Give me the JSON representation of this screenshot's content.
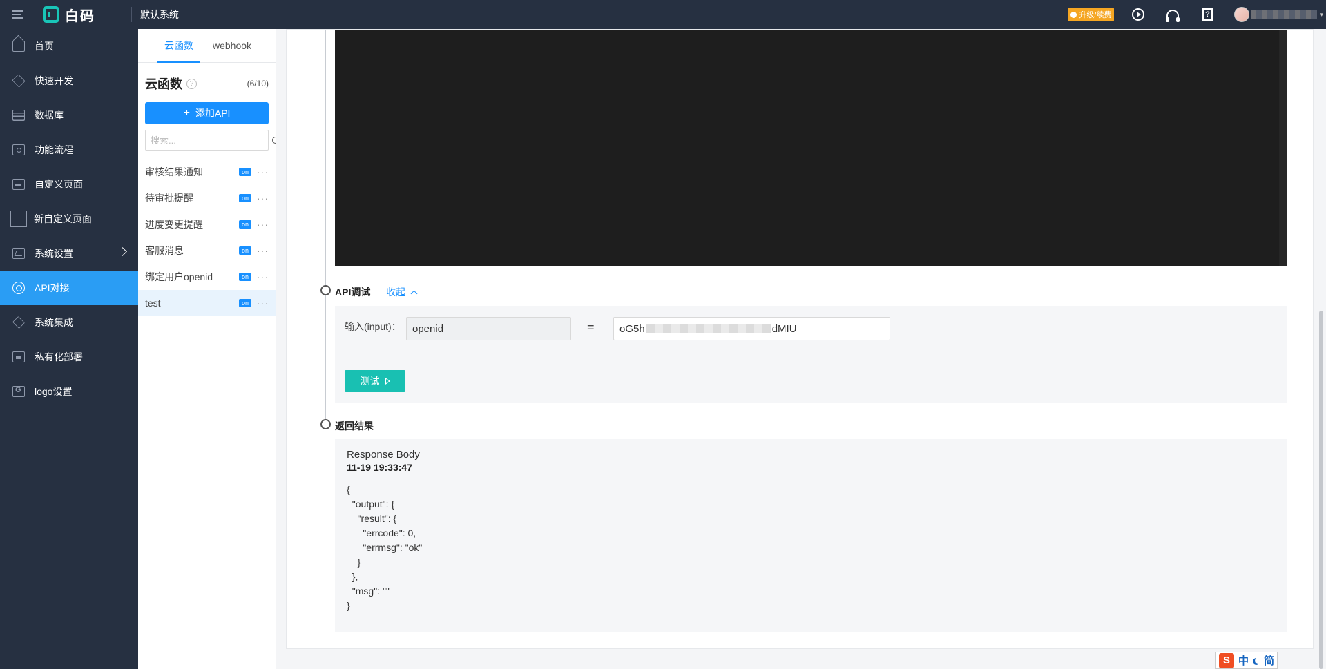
{
  "app": {
    "logo_text": "白码",
    "system_name": "默认系统",
    "upgrade_label": "升级/续费"
  },
  "sidebar": {
    "items": [
      {
        "label": "首页",
        "icon": "home-icon"
      },
      {
        "label": "快速开发",
        "icon": "cube-icon"
      },
      {
        "label": "数据库",
        "icon": "database-icon"
      },
      {
        "label": "功能流程",
        "icon": "flow-icon"
      },
      {
        "label": "自定义页面",
        "icon": "page-icon"
      },
      {
        "label": "新自定义页面",
        "icon": "blank-icon"
      },
      {
        "label": "系统设置",
        "icon": "chart-icon"
      },
      {
        "label": "API对接",
        "icon": "api-icon"
      },
      {
        "label": "系统集成",
        "icon": "layers-icon"
      },
      {
        "label": "私有化部署",
        "icon": "lock-icon"
      },
      {
        "label": "logo设置",
        "icon": "g-logo-icon"
      }
    ],
    "active_index": 7
  },
  "api_panel": {
    "tabs": [
      "云函数",
      "webhook"
    ],
    "active_tab": 0,
    "title": "云函数",
    "count": "(6/10)",
    "add_button": "添加API",
    "search_placeholder": "搜索...",
    "items": [
      {
        "name": "审核结果通知",
        "status": "on"
      },
      {
        "name": "待审批提醒",
        "status": "on"
      },
      {
        "name": "进度变更提醒",
        "status": "on"
      },
      {
        "name": "客服消息",
        "status": "on"
      },
      {
        "name": "绑定用户openid",
        "status": "on"
      },
      {
        "name": "test",
        "status": "on"
      }
    ],
    "selected_index": 5
  },
  "debug": {
    "section_title": "API调试",
    "collapse_label": "收起",
    "input_label": "输入(input)：",
    "input_key": "openid",
    "equals": "=",
    "input_value_start": "oG5h",
    "input_value_end": "dMIU",
    "test_button": "测试"
  },
  "result": {
    "section_title": "返回结果",
    "body_label": "Response Body",
    "timestamp": "11-19 19:33:47",
    "json": "{\n  \"output\": {\n    \"result\": {\n      \"errcode\": 0,\n      \"errmsg\": \"ok\"\n    }\n  },\n  \"msg\": \"\"\n}"
  },
  "ime": {
    "logo": "S",
    "lang": "中",
    "mode": "简"
  }
}
